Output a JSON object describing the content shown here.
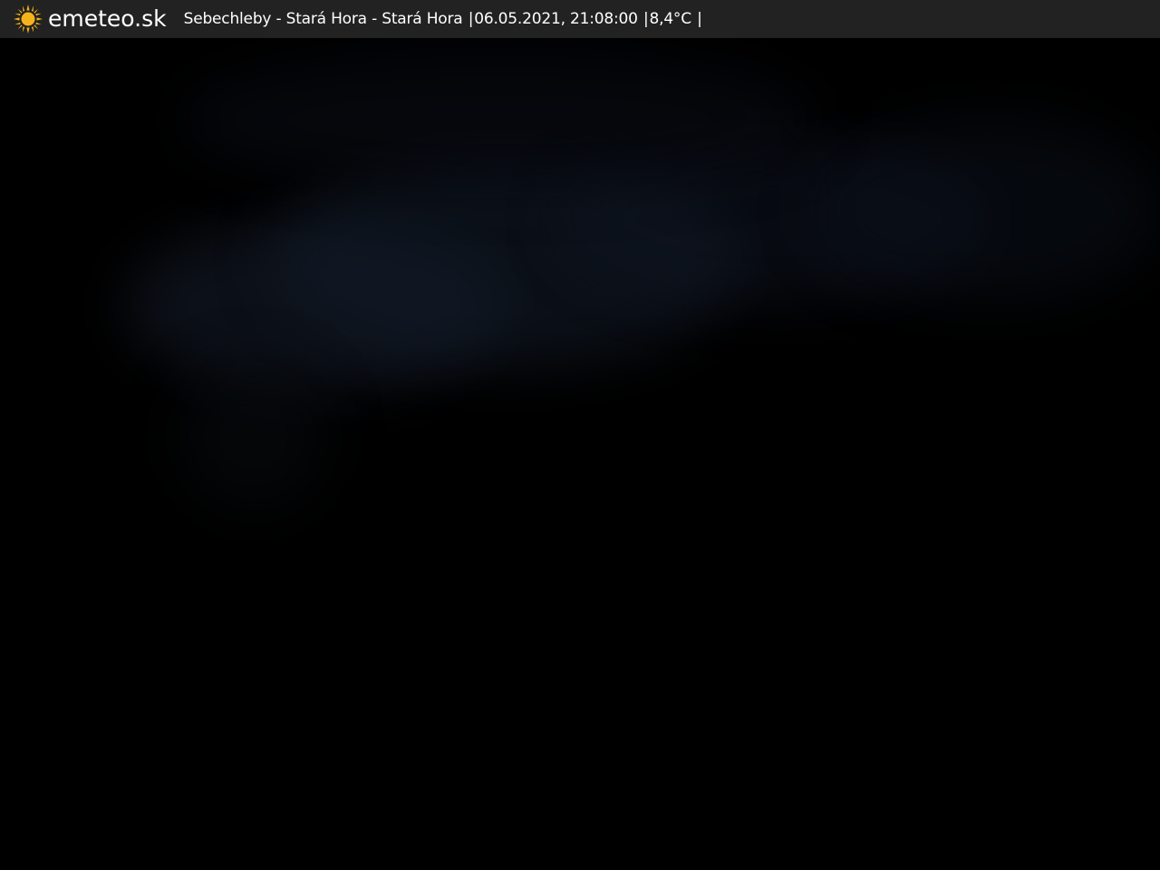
{
  "header": {
    "brand": "emeteo.sk",
    "logo_icon": "sun-icon",
    "logo_color": "#F5B21B",
    "location": "Sebechleby - Stará Hora - Stará Hora",
    "separator": "|",
    "datetime": "06.05.2021, 21:08:00",
    "temperature": "8,4°C"
  },
  "image": {
    "scene": "night-sky-webcam",
    "colors": {
      "bar_background": "#222222",
      "sky_dark": "#000000",
      "cloud_tint": "#0D1420"
    }
  }
}
